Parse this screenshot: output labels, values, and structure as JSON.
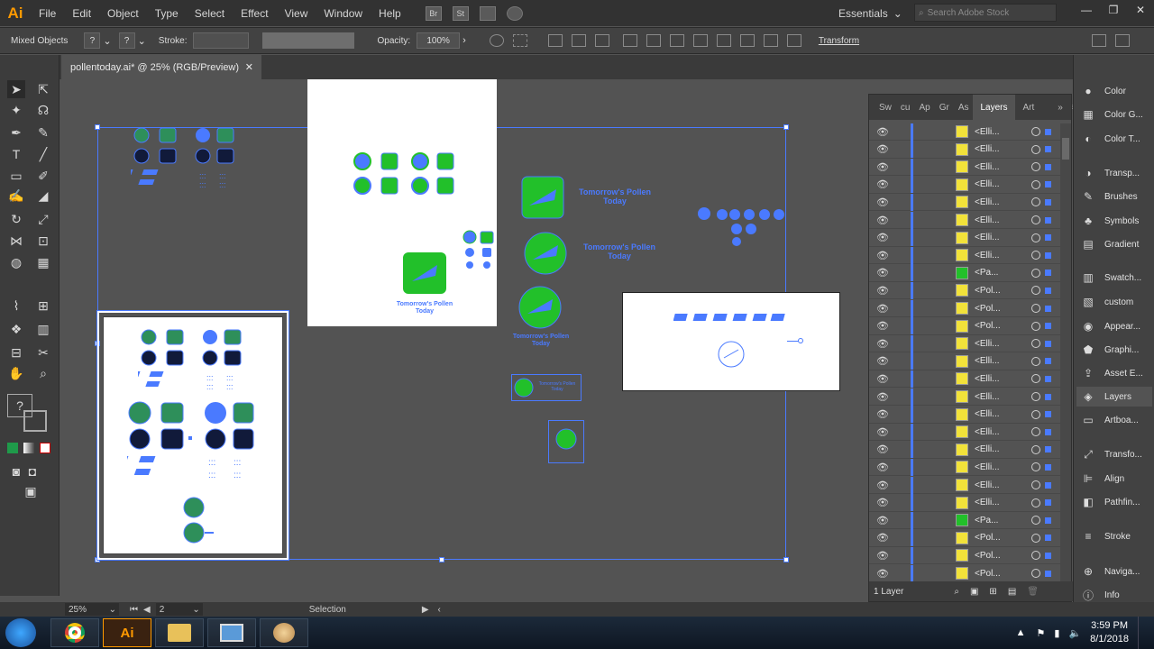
{
  "app": {
    "logo": "Ai"
  },
  "menu": [
    "File",
    "Edit",
    "Object",
    "Type",
    "Select",
    "Effect",
    "View",
    "Window",
    "Help"
  ],
  "menubar_icons": {
    "bridge": "Br",
    "stock": "St"
  },
  "workspace": "Essentials",
  "search": {
    "placeholder": "Search Adobe Stock"
  },
  "control": {
    "selection_label": "Mixed Objects",
    "fill_value": "?",
    "stroke_value": "?",
    "stroke_label": "Stroke:",
    "opacity_label": "Opacity:",
    "opacity_value": "100%",
    "transform_label": "Transform"
  },
  "document": {
    "tab_title": "pollentoday.ai* @ 25% (RGB/Preview)",
    "close": "✕"
  },
  "canvas": {
    "brand_line1": "Tomorrow's Pollen",
    "brand_line2": "Today"
  },
  "layers": {
    "tabs": [
      "Sw",
      "cu",
      "Ap",
      "Gr",
      "As",
      "Layers",
      "Art"
    ],
    "active_tab": "Layers",
    "rows": [
      {
        "name": "<Elli...",
        "color": "#f2e23a"
      },
      {
        "name": "<Elli...",
        "color": "#f2e23a"
      },
      {
        "name": "<Elli...",
        "color": "#f2e23a"
      },
      {
        "name": "<Elli...",
        "color": "#f2e23a"
      },
      {
        "name": "<Elli...",
        "color": "#f2e23a"
      },
      {
        "name": "<Elli...",
        "color": "#f2e23a"
      },
      {
        "name": "<Elli...",
        "color": "#f2e23a"
      },
      {
        "name": "<Elli...",
        "color": "#f2e23a"
      },
      {
        "name": "<Pa...",
        "color": "#22c02a"
      },
      {
        "name": "<Pol...",
        "color": "#f2e23a"
      },
      {
        "name": "<Pol...",
        "color": "#f2e23a"
      },
      {
        "name": "<Pol...",
        "color": "#f2e23a"
      },
      {
        "name": "<Elli...",
        "color": "#f2e23a"
      },
      {
        "name": "<Elli...",
        "color": "#f2e23a"
      },
      {
        "name": "<Elli...",
        "color": "#f2e23a"
      },
      {
        "name": "<Elli...",
        "color": "#f2e23a"
      },
      {
        "name": "<Elli...",
        "color": "#f2e23a"
      },
      {
        "name": "<Elli...",
        "color": "#f2e23a"
      },
      {
        "name": "<Elli...",
        "color": "#f2e23a"
      },
      {
        "name": "<Elli...",
        "color": "#f2e23a"
      },
      {
        "name": "<Elli...",
        "color": "#f2e23a"
      },
      {
        "name": "<Elli...",
        "color": "#f2e23a"
      },
      {
        "name": "<Pa...",
        "color": "#22c02a"
      },
      {
        "name": "<Pol...",
        "color": "#f2e23a"
      },
      {
        "name": "<Pol...",
        "color": "#f2e23a"
      },
      {
        "name": "<Pol...",
        "color": "#f2e23a"
      },
      {
        "name": "<Elli...",
        "color": "#f2e23a"
      }
    ],
    "footer": "1 Layer"
  },
  "right_panels": [
    "Color",
    "Color G...",
    "Color T...",
    "Transp...",
    "Brushes",
    "Symbols",
    "Gradient",
    "Swatch...",
    "custom",
    "Appear...",
    "Graphi...",
    "Asset E...",
    "Layers",
    "Artboa...",
    "Transfo...",
    "Align",
    "Pathfin...",
    "Stroke",
    "Naviga...",
    "Info"
  ],
  "status": {
    "zoom": "25%",
    "artboard": "2",
    "tool": "Selection"
  },
  "taskbar": {
    "time": "3:59 PM",
    "date": "8/1/2018",
    "ai_label": "Ai"
  },
  "colors": {
    "accent": "#4a7aff",
    "green": "#22c02a",
    "yellow": "#f2e23a"
  }
}
